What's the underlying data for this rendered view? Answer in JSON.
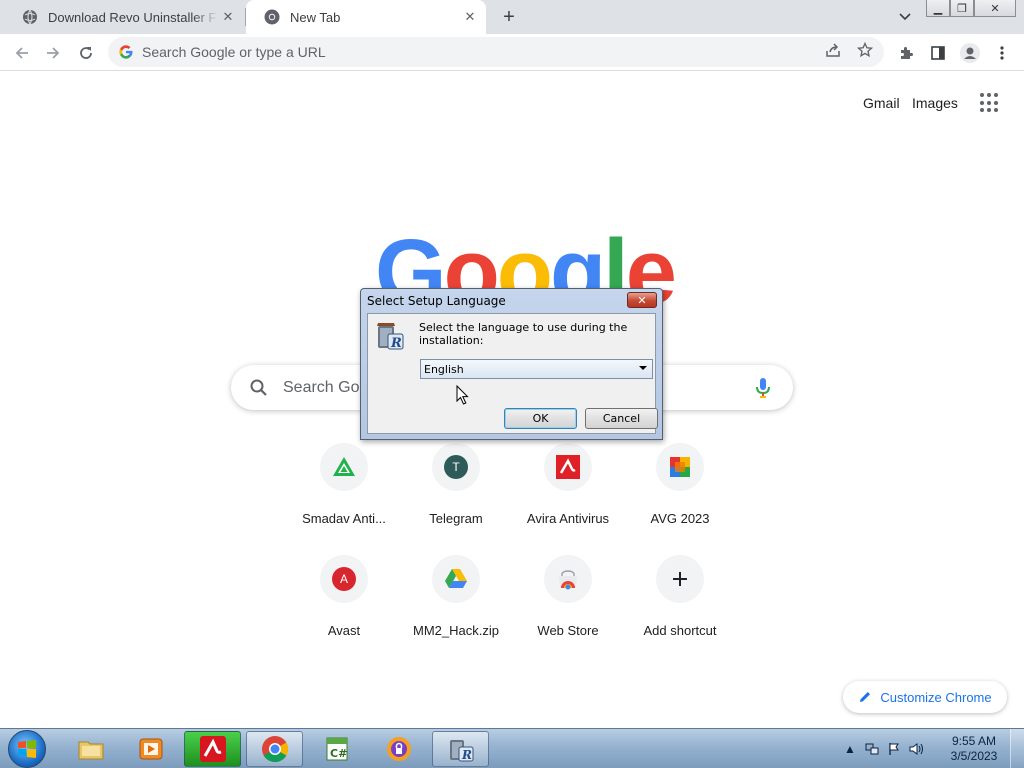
{
  "browser": {
    "tabs": [
      {
        "label": "Download Revo Uninstaller Free"
      },
      {
        "label": "New Tab"
      }
    ],
    "omnibox": {
      "placeholder": "Search Google or type a URL"
    }
  },
  "ntp": {
    "top_links": [
      "Gmail",
      "Images"
    ],
    "search_placeholder": "Search Google",
    "shortcuts": [
      {
        "label": "Smadav Anti...",
        "icon": "smadav-icon"
      },
      {
        "label": "Telegram",
        "icon": "telegram-icon",
        "letter": "T"
      },
      {
        "label": "Avira Antivirus",
        "icon": "avira-icon"
      },
      {
        "label": "AVG 2023",
        "icon": "avg-icon"
      },
      {
        "label": "Avast",
        "icon": "avast-icon",
        "letter": "A"
      },
      {
        "label": "MM2_Hack.zip",
        "icon": "google-drive-icon"
      },
      {
        "label": "Web Store",
        "icon": "web-store-icon"
      },
      {
        "label": "Add shortcut",
        "icon": "plus-icon"
      }
    ],
    "customize_label": "Customize Chrome"
  },
  "dialog": {
    "title": "Select Setup Language",
    "message": "Select the language to use during the installation:",
    "selected_language": "English",
    "ok_label": "OK",
    "cancel_label": "Cancel"
  },
  "taskbar": {
    "clock_time": "9:55 AM",
    "clock_date": "3/5/2023"
  },
  "colors": {
    "google_blue": "#4285f4",
    "google_red": "#ea4335",
    "google_yellow": "#fbbc05",
    "google_green": "#34a853",
    "link_blue": "#1a73e8"
  }
}
